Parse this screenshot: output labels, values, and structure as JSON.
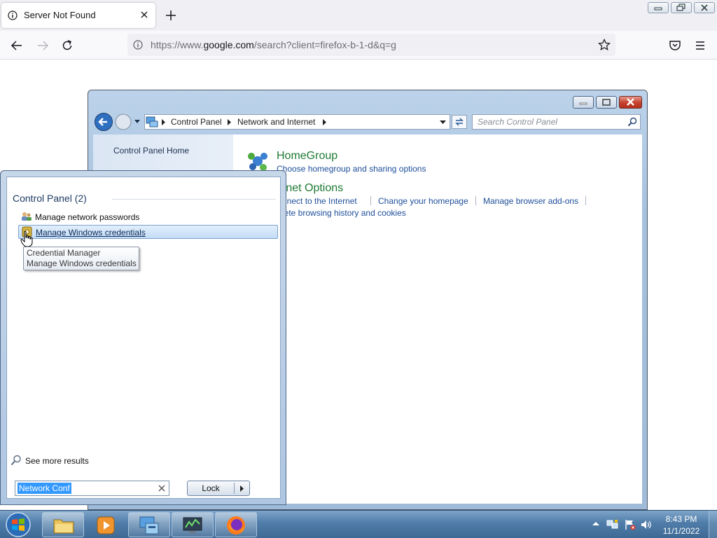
{
  "browser": {
    "tab_title": "Server Not Found",
    "url_prefix": "https://www.",
    "url_domain": "google.com",
    "url_path": "/search?client=firefox-b-1-d&q=g"
  },
  "control_panel": {
    "breadcrumb": [
      "Control Panel",
      "Network and Internet"
    ],
    "search_placeholder": "Search Control Panel",
    "sidebar": {
      "home_label": "Control Panel Home"
    },
    "categories": [
      {
        "title": "HomeGroup",
        "links": [
          "Choose homegroup and sharing options"
        ]
      },
      {
        "title": "rnet Options",
        "links": [
          "nnect to the Internet",
          "Change your homepage",
          "Manage browser add-ons",
          "lete browsing history and cookies"
        ]
      }
    ]
  },
  "start_menu": {
    "group_heading": "Control Panel (2)",
    "results": [
      "Manage network passwords",
      "Manage Windows credentials"
    ],
    "tooltip": [
      "Credential Manager",
      "Manage Windows credentials"
    ],
    "see_more": "See more results",
    "search_value": "Network Conf",
    "lock_label": "Lock"
  },
  "taskbar": {
    "time": "8:43 PM",
    "date": "11/1/2022"
  },
  "colors": {
    "taskbar": "#4f7ca8",
    "cp_link": "#1e4e9a",
    "category_title": "#1e7a34",
    "selection": "#3399ff"
  }
}
